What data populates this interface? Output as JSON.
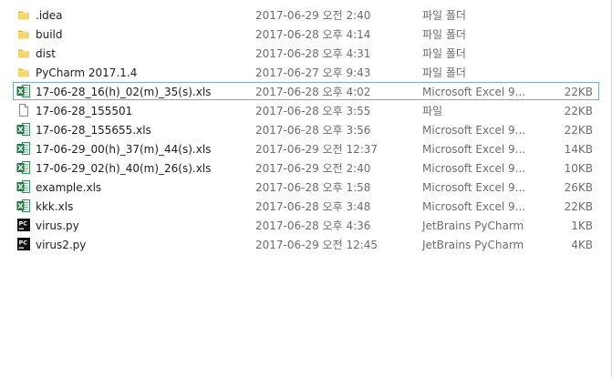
{
  "files": [
    {
      "name": ".idea",
      "date": "2017-06-29 오전 2:40",
      "type": "파일 폴더",
      "size": "",
      "icon": "folder-icon"
    },
    {
      "name": "build",
      "date": "2017-06-28 오후 4:14",
      "type": "파일 폴더",
      "size": "",
      "icon": "folder-icon"
    },
    {
      "name": "dist",
      "date": "2017-06-28 오후 4:31",
      "type": "파일 폴더",
      "size": "",
      "icon": "folder-icon"
    },
    {
      "name": "PyCharm 2017.1.4",
      "date": "2017-06-27 오후 9:43",
      "type": "파일 폴더",
      "size": "",
      "icon": "folder-icon"
    },
    {
      "name": "17-06-28_16(h)_02(m)_35(s).xls",
      "date": "2017-06-28 오후 4:02",
      "type": "Microsoft Excel 9...",
      "size": "22KB",
      "icon": "excel-icon",
      "selected": true
    },
    {
      "name": "17-06-28_155501",
      "date": "2017-06-28 오후 3:55",
      "type": "파일",
      "size": "22KB",
      "icon": "file-icon"
    },
    {
      "name": "17-06-28_155655.xls",
      "date": "2017-06-28 오후 3:56",
      "type": "Microsoft Excel 9...",
      "size": "22KB",
      "icon": "excel-icon"
    },
    {
      "name": "17-06-29_00(h)_37(m)_44(s).xls",
      "date": "2017-06-29 오전 12:37",
      "type": "Microsoft Excel 9...",
      "size": "14KB",
      "icon": "excel-icon"
    },
    {
      "name": "17-06-29_02(h)_40(m)_26(s).xls",
      "date": "2017-06-29 오전 2:40",
      "type": "Microsoft Excel 9...",
      "size": "10KB",
      "icon": "excel-icon"
    },
    {
      "name": "example.xls",
      "date": "2017-06-28 오후 1:58",
      "type": "Microsoft Excel 9...",
      "size": "26KB",
      "icon": "excel-icon"
    },
    {
      "name": "kkk.xls",
      "date": "2017-06-28 오후 3:48",
      "type": "Microsoft Excel 9...",
      "size": "22KB",
      "icon": "excel-icon"
    },
    {
      "name": "virus.py",
      "date": "2017-06-28 오후 4:36",
      "type": "JetBrains PyCharm",
      "size": "1KB",
      "icon": "pycharm-icon"
    },
    {
      "name": "virus2.py",
      "date": "2017-06-29 오전 12:45",
      "type": "JetBrains PyCharm",
      "size": "4KB",
      "icon": "pycharm-icon"
    }
  ]
}
